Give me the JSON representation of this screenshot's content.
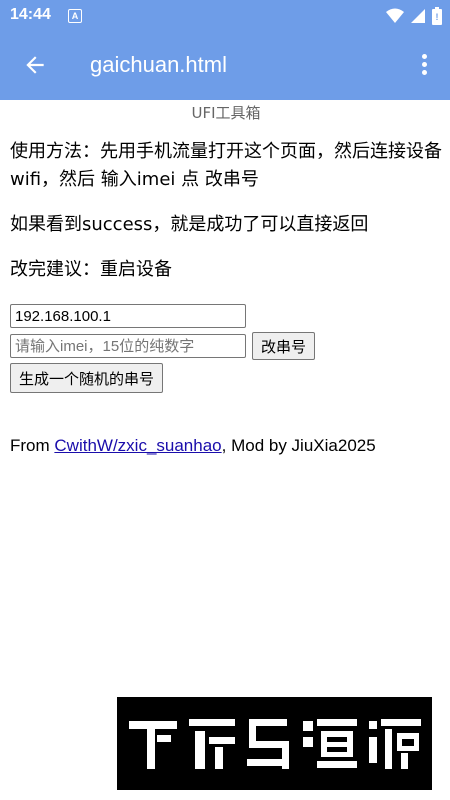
{
  "status_bar": {
    "time": "14:44",
    "notification_letter": "A"
  },
  "app_bar": {
    "title": "gaichuan.html"
  },
  "page": {
    "header": "UFI工具箱",
    "usage": "使用方法：先用手机流量打开这个页面，然后连接设备wifi，然后 输入imei 点 改串号",
    "success_note": "如果看到success，就是成功了可以直接返回",
    "advice": "改完建议：重启设备",
    "ip_value": "192.168.100.1",
    "imei_placeholder": "请输入imei，15位的纯数字",
    "change_button": "改串号",
    "generate_button": "生成一个随机的串号",
    "footer_prefix": "From ",
    "footer_link": "CwithW/zxic_suanhao",
    "footer_suffix": ", Mod by JiuXia2025"
  },
  "watermark": {
    "text": "下载鸟资源"
  },
  "colors": {
    "app_bar": "#6e9de8",
    "link": "#1a0dab"
  }
}
